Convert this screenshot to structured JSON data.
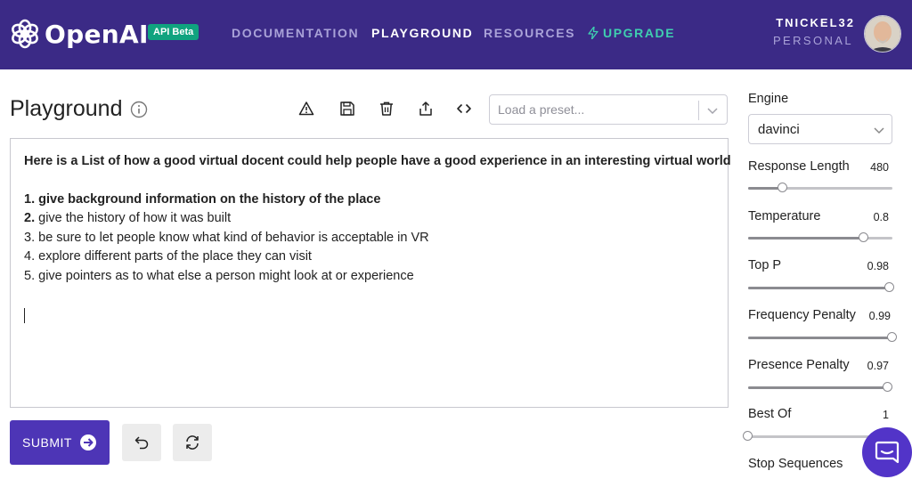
{
  "nav": {
    "logo_text": "OpenAI",
    "badge": "API Beta",
    "links": [
      "DOCUMENTATION",
      "PLAYGROUND",
      "RESOURCES",
      "UPGRADE"
    ],
    "active_link": "PLAYGROUND",
    "user_name": "TNICKEL32",
    "user_plan": "PERSONAL",
    "colors": {
      "bar": "#3b2a86",
      "upgrade": "#3fcfb0",
      "badge": "#10a37f"
    }
  },
  "header": {
    "title": "Playground",
    "preset_placeholder": "Load a preset...",
    "icons": [
      "info-icon",
      "warning-icon",
      "save-icon",
      "trash-icon",
      "share-icon",
      "code-icon",
      "chevron-down-icon"
    ]
  },
  "prompt": {
    "intro": "Here is a List of how a good virtual docent could help people have a good experience in an interesting virtual world",
    "items": [
      {
        "num": "1.",
        "text": "give background information on the history of the place"
      },
      {
        "num": "2.",
        "text": "give the history of how it was built"
      },
      {
        "num": "3.",
        "text": "be sure to let people know what kind of behavior is acceptable in VR"
      },
      {
        "num": "4.",
        "text": "explore different parts of the place they can visit"
      },
      {
        "num": "5.",
        "text": "give pointers as to what else a person might look at or experience"
      }
    ]
  },
  "actions": {
    "submit_label": "SUBMIT",
    "icons": [
      "arrow-right-icon",
      "undo-icon",
      "regenerate-icon"
    ],
    "submit_color": "#4d35b6"
  },
  "settings": {
    "engine_label": "Engine",
    "engine_value": "davinci",
    "sliders": [
      {
        "label": "Response Length",
        "value": "480",
        "fraction": 0.24
      },
      {
        "label": "Temperature",
        "value": "0.8",
        "fraction": 0.8
      },
      {
        "label": "Top P",
        "value": "0.98",
        "fraction": 0.98
      },
      {
        "label": "Frequency Penalty",
        "value": "0.99",
        "fraction": 1.0
      },
      {
        "label": "Presence Penalty",
        "value": "0.97",
        "fraction": 0.97
      },
      {
        "label": "Best Of",
        "value": "1",
        "fraction": 0.0
      }
    ],
    "stop_label": "Stop Sequences"
  },
  "chat": {
    "icon": "chat-bubble-icon",
    "color": "#5234c8"
  }
}
